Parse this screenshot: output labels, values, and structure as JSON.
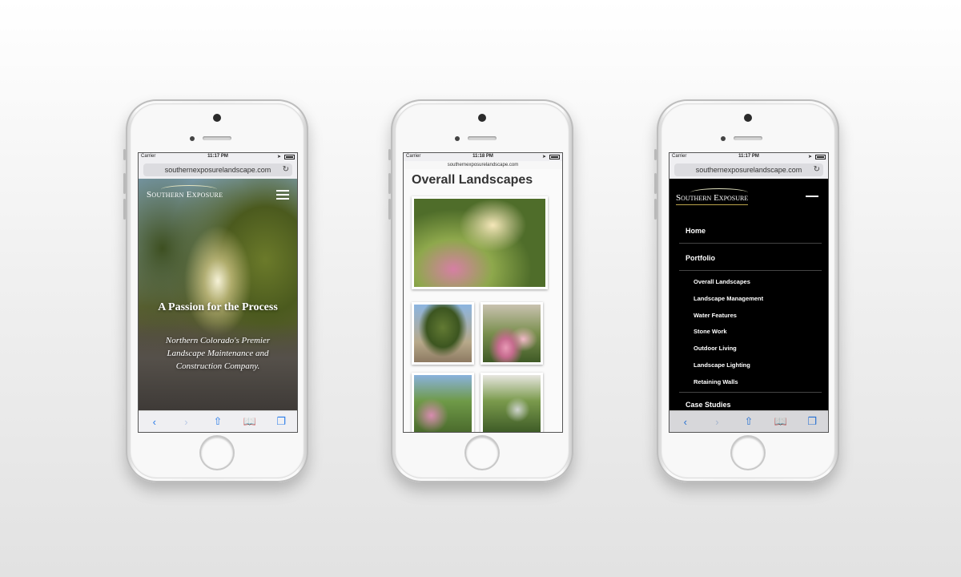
{
  "phones": [
    {
      "status": {
        "carrier": "Carrier",
        "time": "11:17 PM"
      },
      "url": "southernexposurelandscape.com",
      "logo": "Southern Exposure",
      "hero": {
        "title": "A Passion for the Process",
        "subtitle": "Northern Colorado's Premier Landscape Maintenance and Construction Company."
      }
    },
    {
      "status": {
        "carrier": "Carrier",
        "time": "11:18 PM"
      },
      "url": "southernexposurelandscape.com",
      "page_title": "Overall Landscapes"
    },
    {
      "status": {
        "carrier": "Carrier",
        "time": "11:17 PM"
      },
      "url": "southernexposurelandscape.com",
      "logo": "Southern Exposure",
      "menu": {
        "home": "Home",
        "portfolio": "Portfolio",
        "portfolio_items": [
          "Overall Landscapes",
          "Landscape Management",
          "Water Features",
          "Stone Work",
          "Outdoor Living",
          "Landscape Lighting",
          "Retaining Walls"
        ],
        "next": "Case Studies"
      }
    }
  ],
  "toolbar_icons": [
    "back-icon",
    "forward-icon",
    "share-icon",
    "bookmarks-icon",
    "tabs-icon"
  ]
}
